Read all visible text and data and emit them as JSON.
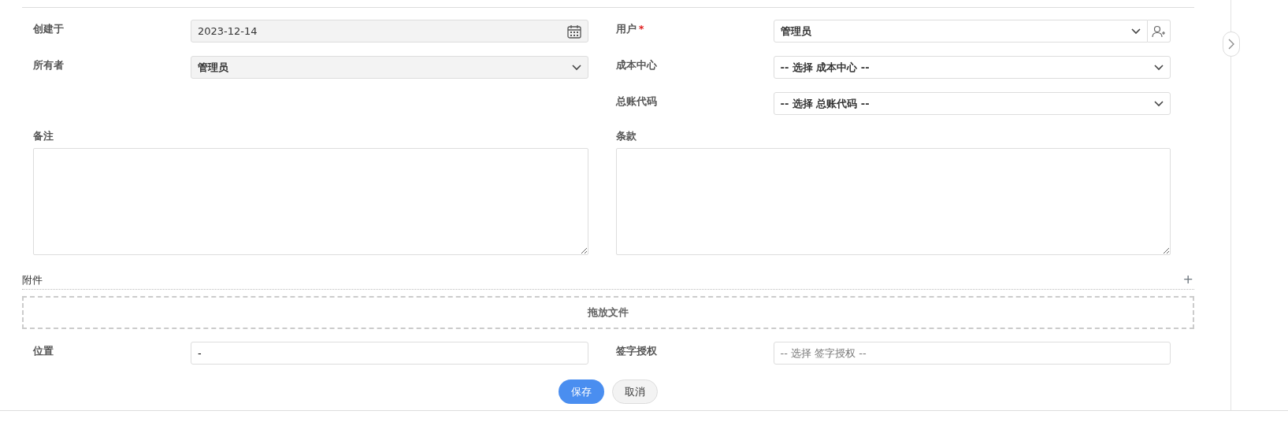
{
  "columns": [
    {
      "fields": [
        {
          "label": "创建于",
          "kind": "date",
          "value": "2023-12-14",
          "disabled": true
        },
        {
          "label": "所有者",
          "kind": "select",
          "value": "管理员",
          "disabled": true
        }
      ]
    },
    {
      "fields": [
        {
          "label": "用户",
          "required_mark": "*",
          "kind": "select_add",
          "value": "管理员",
          "disabled": false
        },
        {
          "label": "成本中心",
          "kind": "select",
          "value": "-- 选择 成本中心 --",
          "disabled": false
        },
        {
          "label": "总账代码",
          "kind": "select",
          "value": "-- 选择 总账代码 --",
          "disabled": false
        }
      ]
    }
  ],
  "notes": [
    {
      "label": "备注"
    },
    {
      "label": "条款"
    }
  ],
  "attachments": {
    "title": "附件",
    "add": "+",
    "dropzone": "拖放文件"
  },
  "bottom_fields": [
    {
      "label": "位置",
      "kind": "text",
      "value": "-"
    },
    {
      "label": "签字授权",
      "kind": "text",
      "placeholder": "-- 选择 签字授权 --"
    }
  ],
  "buttons": [
    {
      "label": "保存",
      "kind": "primary"
    },
    {
      "label": "取消",
      "kind": "secondary"
    }
  ]
}
